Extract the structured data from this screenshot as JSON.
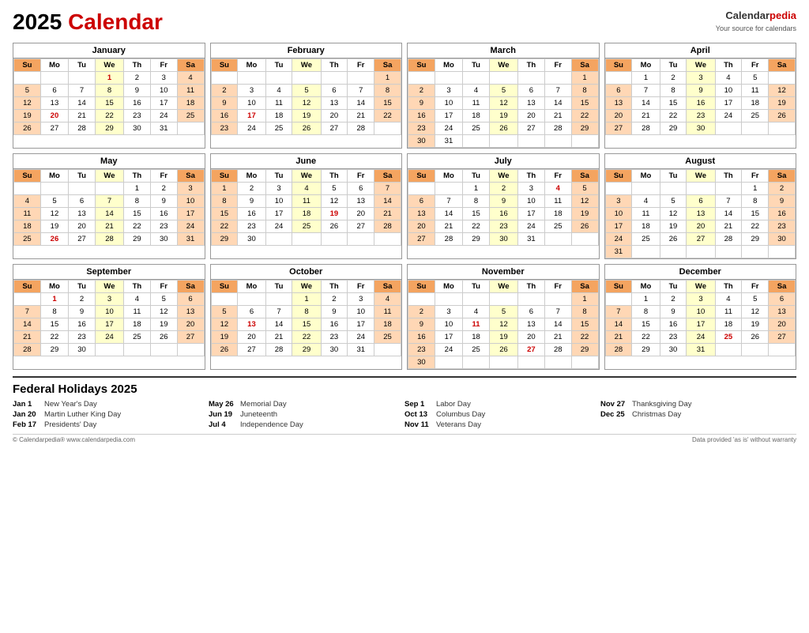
{
  "title": "2025 Calendar",
  "brand": "Calendar",
  "brand_accent": "pedia",
  "brand_sub": "Your source for calendars",
  "months": [
    {
      "name": "January",
      "weeks": [
        [
          "",
          "",
          "",
          "1",
          "2",
          "3",
          "4"
        ],
        [
          "5",
          "6",
          "7",
          "8",
          "9",
          "10",
          "11"
        ],
        [
          "12",
          "13",
          "14",
          "15",
          "16",
          "17",
          "18"
        ],
        [
          "19",
          "20",
          "21",
          "22",
          "23",
          "24",
          "25"
        ],
        [
          "26",
          "27",
          "28",
          "29",
          "30",
          "31",
          ""
        ]
      ],
      "specials": {
        "1": "holiday",
        "20": "holiday"
      }
    },
    {
      "name": "February",
      "weeks": [
        [
          "",
          "",
          "",
          "",
          "",
          "",
          "1"
        ],
        [
          "2",
          "3",
          "4",
          "5",
          "6",
          "7",
          "8"
        ],
        [
          "9",
          "10",
          "11",
          "12",
          "13",
          "14",
          "15"
        ],
        [
          "16",
          "17",
          "18",
          "19",
          "20",
          "21",
          "22"
        ],
        [
          "23",
          "24",
          "25",
          "26",
          "27",
          "28",
          ""
        ]
      ],
      "specials": {
        "17": "holiday"
      }
    },
    {
      "name": "March",
      "weeks": [
        [
          "",
          "",
          "",
          "",
          "",
          "",
          "1"
        ],
        [
          "2",
          "3",
          "4",
          "5",
          "6",
          "7",
          "8"
        ],
        [
          "9",
          "10",
          "11",
          "12",
          "13",
          "14",
          "15"
        ],
        [
          "16",
          "17",
          "18",
          "19",
          "20",
          "21",
          "22"
        ],
        [
          "23",
          "24",
          "25",
          "26",
          "27",
          "28",
          "29"
        ],
        [
          "30",
          "31",
          "",
          "",
          "",
          "",
          ""
        ]
      ],
      "specials": {}
    },
    {
      "name": "April",
      "weeks": [
        [
          "",
          "1",
          "2",
          "3",
          "4",
          "5",
          ""
        ],
        [
          "6",
          "7",
          "8",
          "9",
          "10",
          "11",
          "12"
        ],
        [
          "13",
          "14",
          "15",
          "16",
          "17",
          "18",
          "19"
        ],
        [
          "20",
          "21",
          "22",
          "23",
          "24",
          "25",
          "26"
        ],
        [
          "27",
          "28",
          "29",
          "30",
          "",
          "",
          ""
        ]
      ],
      "specials": {}
    },
    {
      "name": "May",
      "weeks": [
        [
          "",
          "",
          "",
          "",
          "1",
          "2",
          "3"
        ],
        [
          "4",
          "5",
          "6",
          "7",
          "8",
          "9",
          "10"
        ],
        [
          "11",
          "12",
          "13",
          "14",
          "15",
          "16",
          "17"
        ],
        [
          "18",
          "19",
          "20",
          "21",
          "22",
          "23",
          "24"
        ],
        [
          "25",
          "26",
          "27",
          "28",
          "29",
          "30",
          "31"
        ]
      ],
      "specials": {
        "26": "holiday"
      }
    },
    {
      "name": "June",
      "weeks": [
        [
          "1",
          "2",
          "3",
          "4",
          "5",
          "6",
          "7"
        ],
        [
          "8",
          "9",
          "10",
          "11",
          "12",
          "13",
          "14"
        ],
        [
          "15",
          "16",
          "17",
          "18",
          "19",
          "20",
          "21"
        ],
        [
          "22",
          "23",
          "24",
          "25",
          "26",
          "27",
          "28"
        ],
        [
          "29",
          "30",
          "",
          "",
          "",
          "",
          ""
        ]
      ],
      "specials": {
        "19": "holiday"
      }
    },
    {
      "name": "July",
      "weeks": [
        [
          "",
          "",
          "1",
          "2",
          "3",
          "4",
          "5"
        ],
        [
          "6",
          "7",
          "8",
          "9",
          "10",
          "11",
          "12"
        ],
        [
          "13",
          "14",
          "15",
          "16",
          "17",
          "18",
          "19"
        ],
        [
          "20",
          "21",
          "22",
          "23",
          "24",
          "25",
          "26"
        ],
        [
          "27",
          "28",
          "29",
          "30",
          "31",
          "",
          ""
        ]
      ],
      "specials": {
        "4": "holiday"
      }
    },
    {
      "name": "August",
      "weeks": [
        [
          "",
          "",
          "",
          "",
          "",
          "1",
          "2"
        ],
        [
          "3",
          "4",
          "5",
          "6",
          "7",
          "8",
          "9"
        ],
        [
          "10",
          "11",
          "12",
          "13",
          "14",
          "15",
          "16"
        ],
        [
          "17",
          "18",
          "19",
          "20",
          "21",
          "22",
          "23"
        ],
        [
          "24",
          "25",
          "26",
          "27",
          "28",
          "29",
          "30"
        ],
        [
          "31",
          "",
          "",
          "",
          "",
          "",
          ""
        ]
      ],
      "specials": {}
    },
    {
      "name": "September",
      "weeks": [
        [
          "",
          "1",
          "2",
          "3",
          "4",
          "5",
          "6"
        ],
        [
          "7",
          "8",
          "9",
          "10",
          "11",
          "12",
          "13"
        ],
        [
          "14",
          "15",
          "16",
          "17",
          "18",
          "19",
          "20"
        ],
        [
          "21",
          "22",
          "23",
          "24",
          "25",
          "26",
          "27"
        ],
        [
          "28",
          "29",
          "30",
          "",
          "",
          "",
          ""
        ]
      ],
      "specials": {
        "1": "holiday"
      }
    },
    {
      "name": "October",
      "weeks": [
        [
          "",
          "",
          "",
          "1",
          "2",
          "3",
          "4"
        ],
        [
          "5",
          "6",
          "7",
          "8",
          "9",
          "10",
          "11"
        ],
        [
          "12",
          "13",
          "14",
          "15",
          "16",
          "17",
          "18"
        ],
        [
          "19",
          "20",
          "21",
          "22",
          "23",
          "24",
          "25"
        ],
        [
          "26",
          "27",
          "28",
          "29",
          "30",
          "31",
          ""
        ]
      ],
      "specials": {
        "13": "holiday"
      }
    },
    {
      "name": "November",
      "weeks": [
        [
          "",
          "",
          "",
          "",
          "",
          "",
          "1"
        ],
        [
          "2",
          "3",
          "4",
          "5",
          "6",
          "7",
          "8"
        ],
        [
          "9",
          "10",
          "11",
          "12",
          "13",
          "14",
          "15"
        ],
        [
          "16",
          "17",
          "18",
          "19",
          "20",
          "21",
          "22"
        ],
        [
          "23",
          "24",
          "25",
          "26",
          "27",
          "28",
          "29"
        ],
        [
          "30",
          "",
          "",
          "",
          "",
          "",
          ""
        ]
      ],
      "specials": {
        "11": "holiday",
        "27": "holiday"
      }
    },
    {
      "name": "December",
      "weeks": [
        [
          "",
          "1",
          "2",
          "3",
          "4",
          "5",
          "6"
        ],
        [
          "7",
          "8",
          "9",
          "10",
          "11",
          "12",
          "13"
        ],
        [
          "14",
          "15",
          "16",
          "17",
          "18",
          "19",
          "20"
        ],
        [
          "21",
          "22",
          "23",
          "24",
          "25",
          "26",
          "27"
        ],
        [
          "28",
          "29",
          "30",
          "31",
          "",
          "",
          ""
        ]
      ],
      "specials": {
        "25": "holiday"
      }
    }
  ],
  "holidays_title": "Federal Holidays 2025",
  "holidays_columns": [
    [
      {
        "date": "Jan 1",
        "name": "New Year's Day"
      },
      {
        "date": "Jan 20",
        "name": "Martin Luther King Day"
      },
      {
        "date": "Feb 17",
        "name": "Presidents' Day"
      }
    ],
    [
      {
        "date": "May 26",
        "name": "Memorial Day"
      },
      {
        "date": "Jun 19",
        "name": "Juneteenth"
      },
      {
        "date": "Jul 4",
        "name": "Independence Day"
      }
    ],
    [
      {
        "date": "Sep 1",
        "name": "Labor Day"
      },
      {
        "date": "Oct 13",
        "name": "Columbus Day"
      },
      {
        "date": "Nov 11",
        "name": "Veterans Day"
      }
    ],
    [
      {
        "date": "Nov 27",
        "name": "Thanksgiving Day"
      },
      {
        "date": "Dec 25",
        "name": "Christmas Day"
      }
    ]
  ],
  "footer_left": "© Calendarpedia®  www.calendarpedia.com",
  "footer_right": "Data provided 'as is' without warranty"
}
